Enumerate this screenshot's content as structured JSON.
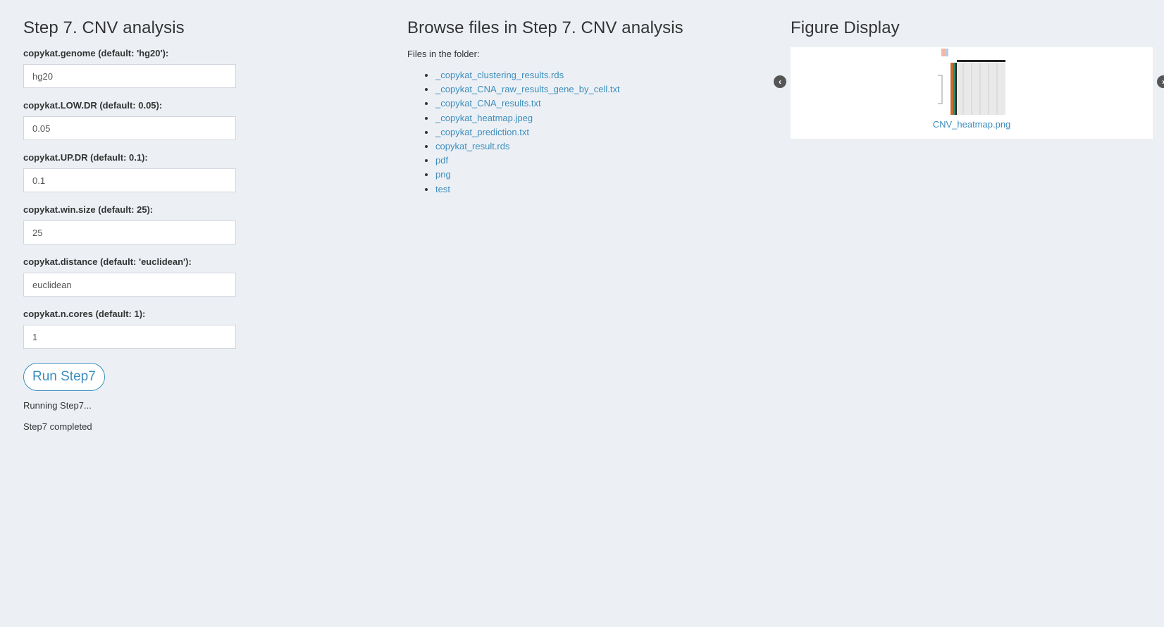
{
  "step_panel": {
    "title": "Step 7. CNV analysis",
    "fields": [
      {
        "label": "copykat.genome (default: 'hg20'):",
        "value": "hg20"
      },
      {
        "label": "copykat.LOW.DR (default: 0.05):",
        "value": "0.05"
      },
      {
        "label": "copykat.UP.DR (default: 0.1):",
        "value": "0.1"
      },
      {
        "label": "copykat.win.size (default: 25):",
        "value": "25"
      },
      {
        "label": "copykat.distance (default: 'euclidean'):",
        "value": "euclidean"
      },
      {
        "label": "copykat.n.cores (default: 1):",
        "value": "1"
      }
    ],
    "run_button_label": "Run Step7",
    "status_lines": [
      "Running Step7...",
      "Step7 completed"
    ]
  },
  "browse_panel": {
    "title": "Browse files in Step 7. CNV analysis",
    "caption": "Files in the folder:",
    "files": [
      "_copykat_clustering_results.rds",
      "_copykat_CNA_raw_results_gene_by_cell.txt",
      "_copykat_CNA_results.txt",
      "_copykat_heatmap.jpeg",
      "_copykat_prediction.txt",
      "copykat_result.rds",
      "pdf",
      "png",
      "test"
    ]
  },
  "figure_panel": {
    "title": "Figure Display",
    "image_caption": "CNV_heatmap.png",
    "prev_icon": "chevron-left-circle-icon",
    "next_icon": "chevron-right-circle-icon"
  },
  "colors": {
    "background": "#ecf0f5",
    "link": "#3c8dbc",
    "text": "#333333"
  }
}
